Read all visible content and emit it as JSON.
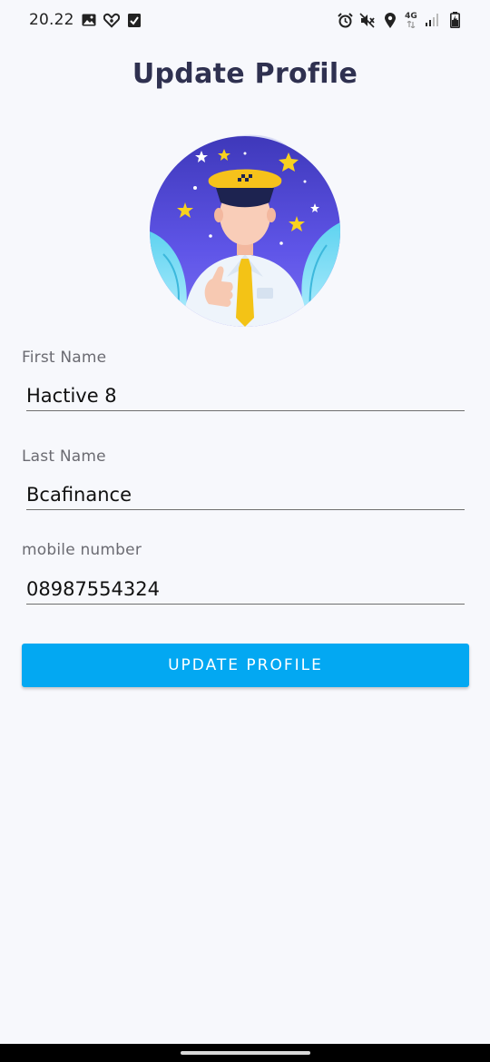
{
  "status_bar": {
    "time": "20.22",
    "network_label": "4G",
    "icons": [
      "gallery-icon",
      "heart-app-icon",
      "checkbox-icon",
      "alarm-icon",
      "mute-icon",
      "location-icon",
      "signal-icon",
      "battery-charging-icon"
    ]
  },
  "page": {
    "title": "Update Profile",
    "avatar": "driver-illustration"
  },
  "form": {
    "first_name": {
      "label": "First Name",
      "value": "Hactive 8"
    },
    "last_name": {
      "label": "Last Name",
      "value": "Bcafinance"
    },
    "mobile": {
      "label": "mobile number",
      "value": "08987554324"
    }
  },
  "actions": {
    "update_label": "UPDATE PROFILE",
    "accent_color": "#03a8f2"
  }
}
